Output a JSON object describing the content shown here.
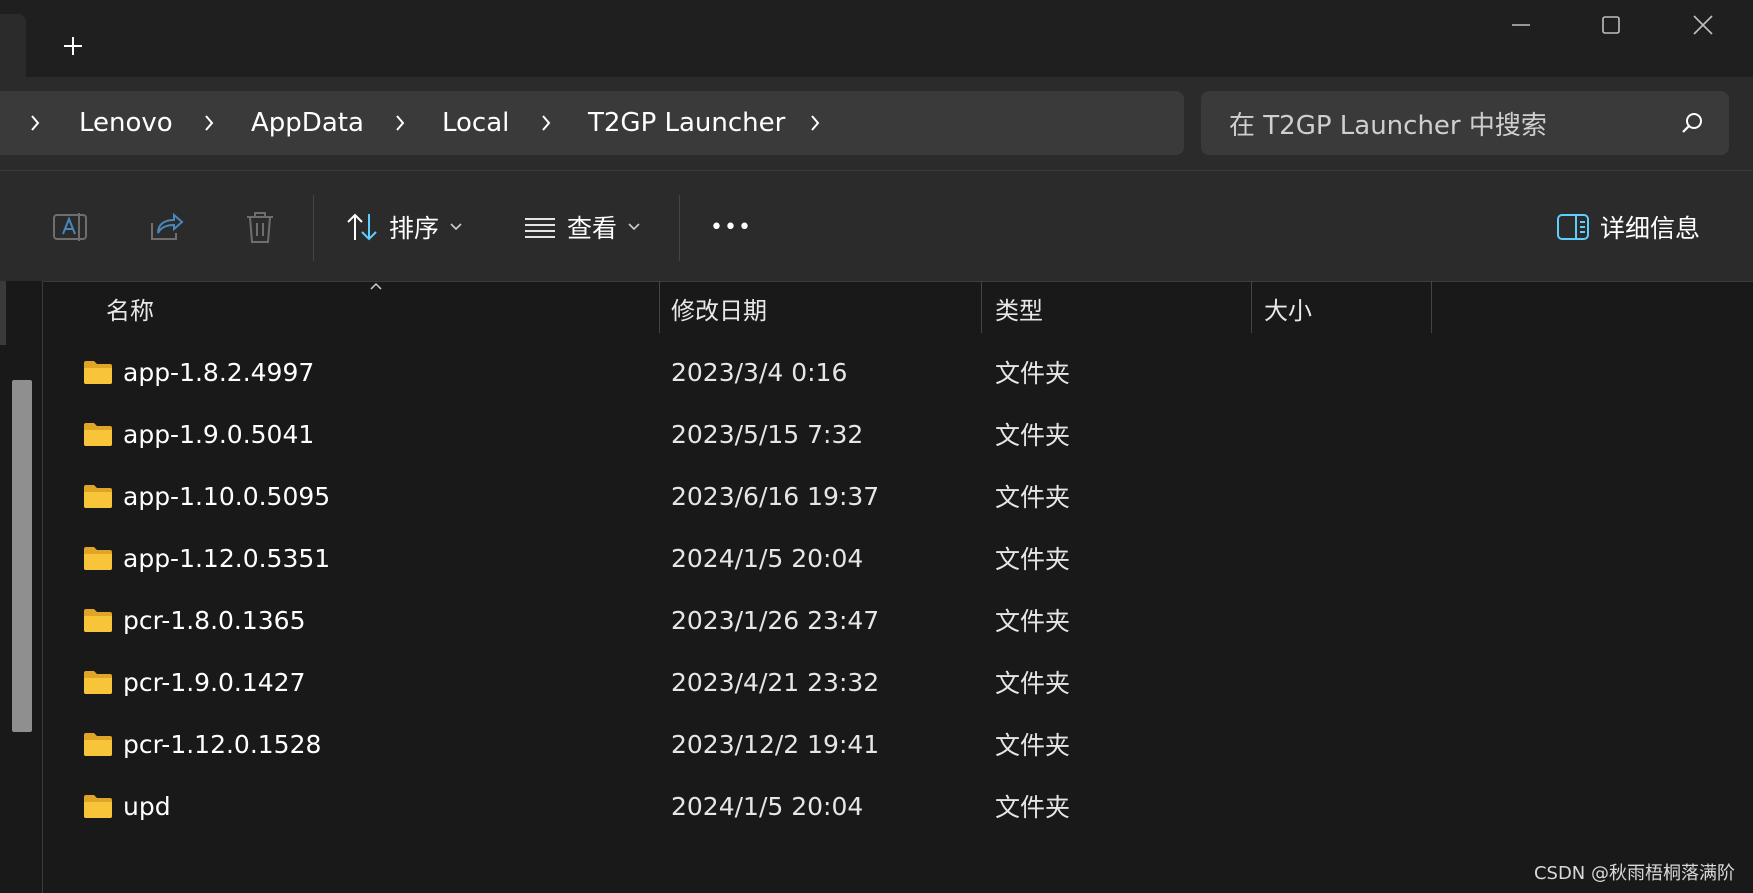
{
  "titlebar": {
    "new_tab_label": "+"
  },
  "address": {
    "crumbs": [
      "Lenovo",
      "AppData",
      "Local",
      "T2GP Launcher"
    ]
  },
  "search": {
    "placeholder": "在 T2GP Launcher 中搜索"
  },
  "toolbar": {
    "sort_label": "排序",
    "view_label": "查看",
    "more_label": "•••",
    "details_label": "详细信息"
  },
  "columns": {
    "name": "名称",
    "modified": "修改日期",
    "type": "类型",
    "size": "大小"
  },
  "files": [
    {
      "name": "app-1.8.2.4997",
      "modified": "2023/3/4 0:16",
      "type": "文件夹"
    },
    {
      "name": "app-1.9.0.5041",
      "modified": "2023/5/15 7:32",
      "type": "文件夹"
    },
    {
      "name": "app-1.10.0.5095",
      "modified": "2023/6/16 19:37",
      "type": "文件夹"
    },
    {
      "name": "app-1.12.0.5351",
      "modified": "2024/1/5 20:04",
      "type": "文件夹"
    },
    {
      "name": "pcr-1.8.0.1365",
      "modified": "2023/1/26 23:47",
      "type": "文件夹"
    },
    {
      "name": "pcr-1.9.0.1427",
      "modified": "2023/4/21 23:32",
      "type": "文件夹"
    },
    {
      "name": "pcr-1.12.0.1528",
      "modified": "2023/12/2 19:41",
      "type": "文件夹"
    },
    {
      "name": "upd",
      "modified": "2024/1/5 20:04",
      "type": "文件夹"
    }
  ],
  "watermark": "CSDN @秋雨梧桐落满阶",
  "colors": {
    "background": "#191919",
    "toolbar": "#2b2b2b",
    "field": "#3a3a3a",
    "folder": "#f8c53a",
    "details_accent": "#60cdff"
  }
}
